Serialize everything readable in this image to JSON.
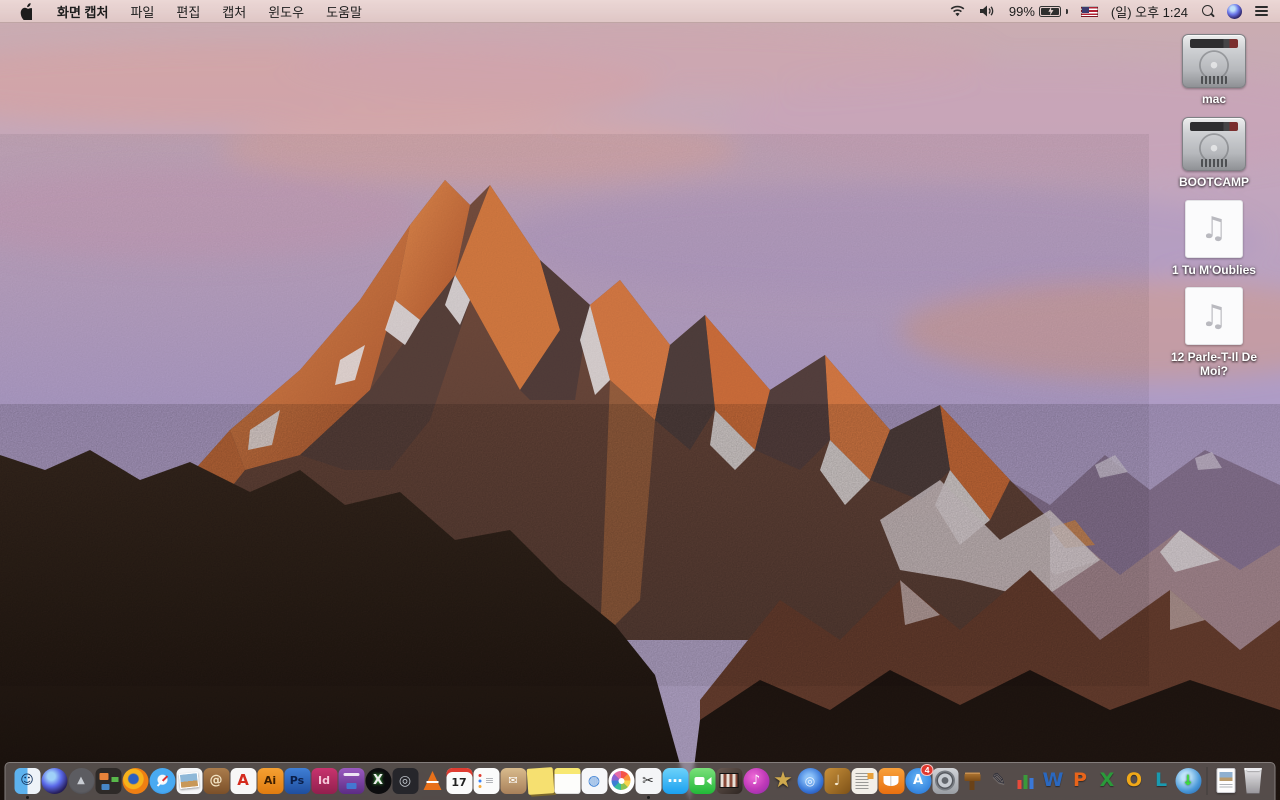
{
  "menu_bar": {
    "menus": [
      {
        "name": "app-menu-screen-capture",
        "label": "화면 캡처",
        "bold": true
      },
      {
        "name": "menu-file",
        "label": "파일"
      },
      {
        "name": "menu-edit",
        "label": "편집"
      },
      {
        "name": "menu-capture",
        "label": "캡처"
      },
      {
        "name": "menu-window",
        "label": "윈도우"
      },
      {
        "name": "menu-help",
        "label": "도움말"
      }
    ],
    "status": {
      "battery_percent": "99%",
      "clock": "(일) 오후 1:24"
    }
  },
  "desktop_icons": [
    {
      "name": "desktop-drive-mac",
      "cls": "drive",
      "label": "mac"
    },
    {
      "name": "desktop-drive-bootcamp",
      "cls": "drive",
      "label": "BOOTCAMP"
    },
    {
      "name": "desktop-audio-file-1",
      "cls": "audio",
      "label": "1 Tu M'Oublies",
      "glyph": "♫"
    },
    {
      "name": "desktop-audio-file-2",
      "cls": "audio",
      "label": "12 Parle-T-Il De Moi?",
      "glyph": "♫"
    }
  ],
  "dock": {
    "items": [
      {
        "name": "dock-finder",
        "cls": "ic-finder",
        "glyph": "☺",
        "run": true
      },
      {
        "name": "dock-siri",
        "cls": "circ ic-siri"
      },
      {
        "name": "dock-launchpad",
        "cls": "circ ic-launchpad",
        "glyph": "▲"
      },
      {
        "name": "dock-mission-control",
        "cls": "ic-mc"
      },
      {
        "name": "dock-firefox",
        "cls": "circ ic-firefox"
      },
      {
        "name": "dock-safari",
        "cls": "circ ic-safari"
      },
      {
        "name": "dock-preview",
        "cls": "ic-photo"
      },
      {
        "name": "dock-address-book",
        "cls": "ic-bookbrown",
        "glyph": "@"
      },
      {
        "name": "dock-acrobat",
        "cls": "ic-acrobat",
        "glyph": "A"
      },
      {
        "name": "dock-illustrator",
        "cls": "ic-ai",
        "glyph": "Ai"
      },
      {
        "name": "dock-photoshop",
        "cls": "ic-ps",
        "glyph": "Ps"
      },
      {
        "name": "dock-indesign",
        "cls": "ic-id",
        "glyph": "Id"
      },
      {
        "name": "dock-toast",
        "cls": "ic-toast"
      },
      {
        "name": "dock-x-app",
        "cls": "circ ic-x",
        "glyph": "X"
      },
      {
        "name": "dock-disc-app",
        "cls": "ic-disc",
        "glyph": "◎"
      },
      {
        "name": "dock-vlc",
        "cls": "ic-vlc"
      },
      {
        "name": "dock-calendar",
        "cls": "ic-cal",
        "glyph": "17"
      },
      {
        "name": "dock-reminders",
        "cls": "ic-rem",
        "glyph": "≡"
      },
      {
        "name": "dock-archive-utility",
        "cls": "ic-archive",
        "glyph": "✉"
      },
      {
        "name": "dock-stickies",
        "cls": "ic-stickies"
      },
      {
        "name": "dock-notes",
        "cls": "ic-notes"
      },
      {
        "name": "dock-media-compass-app",
        "cls": "ic-compass",
        "glyph": "◍"
      },
      {
        "name": "dock-photos",
        "cls": "circ ic-photos"
      },
      {
        "name": "dock-screen-capture-grab",
        "cls": "ic-grab",
        "glyph": "✂",
        "run": true
      },
      {
        "name": "dock-messages",
        "cls": "ic-msg",
        "glyph": "…"
      },
      {
        "name": "dock-facetime",
        "cls": "ic-facetime"
      },
      {
        "name": "dock-photo-booth",
        "cls": "ic-pbooth"
      },
      {
        "name": "dock-itunes",
        "cls": "circ ic-itunes",
        "glyph": "♪"
      },
      {
        "name": "dock-imovie-star",
        "cls": "ic-star",
        "glyph": "★"
      },
      {
        "name": "dock-dvd-app",
        "cls": "circ ic-dvd",
        "glyph": "◎"
      },
      {
        "name": "dock-garageband",
        "cls": "ic-gb",
        "glyph": "♩"
      },
      {
        "name": "dock-news-app",
        "cls": "ic-news"
      },
      {
        "name": "dock-ibooks",
        "cls": "ic-ibooks"
      },
      {
        "name": "dock-app-store",
        "cls": "circ ic-appstore",
        "glyph": "A",
        "badge": "4"
      },
      {
        "name": "dock-system-preferences",
        "cls": "ic-prefs"
      },
      {
        "name": "dock-keynote",
        "cls": "ic-podium"
      },
      {
        "name": "dock-pages",
        "cls": "ic-pen",
        "glyph": "✎"
      },
      {
        "name": "dock-numbers",
        "cls": "ic-numbers"
      },
      {
        "name": "dock-word",
        "cls": "ic-letter ic-word",
        "glyph": "W"
      },
      {
        "name": "dock-powerpoint",
        "cls": "ic-letter ic-ppt",
        "glyph": "P"
      },
      {
        "name": "dock-excel",
        "cls": "ic-letter ic-excel",
        "glyph": "X"
      },
      {
        "name": "dock-outlook",
        "cls": "ic-letter ic-outlook",
        "glyph": "O"
      },
      {
        "name": "dock-lync",
        "cls": "ic-letter ic-lync",
        "glyph": "L"
      },
      {
        "name": "dock-download-manager",
        "cls": "circ ic-globedl",
        "glyph": "↓"
      },
      {
        "sep": true
      },
      {
        "name": "dock-document-file",
        "cls": "ic-doc"
      },
      {
        "name": "dock-trash",
        "cls": "ic-trash"
      }
    ]
  },
  "colors": {
    "menubar_tint": "#ecd8d6",
    "dock_tint": "rgba(131,124,123,0.55)",
    "badge_red": "#e0382e",
    "wallpaper_sky_top": "#cbadb0",
    "wallpaper_sky_mid": "#ae9cc6",
    "wallpaper_sunlit_rock": "#d97b45",
    "wallpaper_shadow_rock": "#4e3b38",
    "wallpaper_foreground": "#241a15"
  }
}
